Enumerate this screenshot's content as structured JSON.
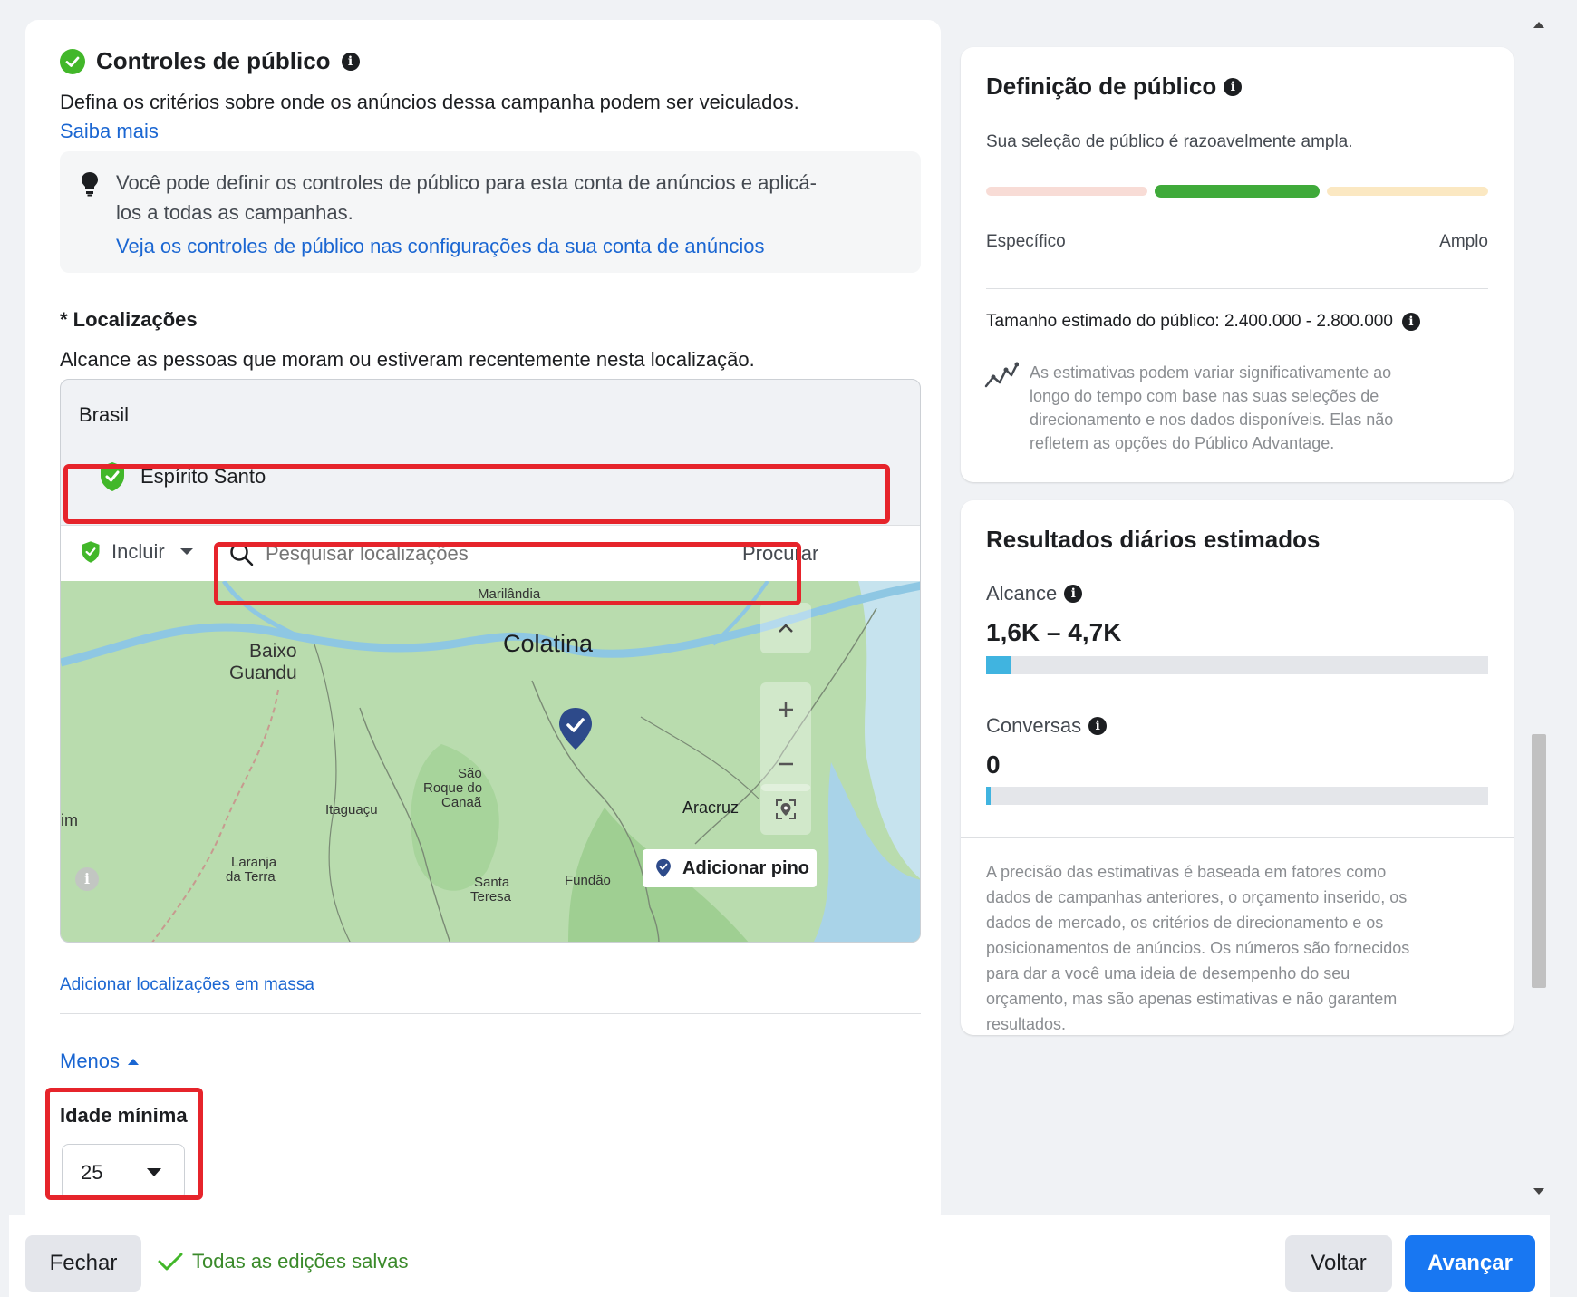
{
  "audience_controls": {
    "title": "Controles de público",
    "description": "Defina os critérios sobre onde os anúncios dessa campanha podem ser veiculados.",
    "learn_more": "Saiba mais",
    "tip_text_line1": "Você pode definir os controles de público para esta conta de anúncios e aplicá-",
    "tip_text_line2": "los a todas as campanhas.",
    "tip_link": "Veja os controles de público nas configurações da sua conta de anúncios"
  },
  "locations": {
    "label": "* Localizações",
    "description": "Alcance as pessoas que moram ou estiveram recentemente nesta localização.",
    "country": "Brasil",
    "selected_location": "Espírito Santo",
    "include_label": "Incluir",
    "search_placeholder": "Pesquisar localizações",
    "search_button": "Procurar",
    "bulk_add": "Adicionar localizações em massa",
    "add_pin": "Adicionar pino"
  },
  "map": {
    "labels": {
      "marilandia": "Marilândia",
      "colatina": "Colatina",
      "baixo": "Baixo",
      "guandu": "Guandu",
      "sao": "São",
      "roque": "Roque do",
      "canaa": "Canaã",
      "itaguacu": "Itaguaçu",
      "aracruz": "Aracruz",
      "im": "im",
      "laranja": "Laranja",
      "daterra": "da Terra",
      "santa": "Santa",
      "teresa": "Teresa",
      "fundao": "Fundão"
    }
  },
  "less_toggle": "Menos",
  "min_age": {
    "label": "Idade mínima",
    "value": "25"
  },
  "audience_definition": {
    "title": "Definição de público",
    "summary": "Sua seleção de público é razoavelmente ampla.",
    "specific_label": "Específico",
    "broad_label": "Amplo",
    "estimated_size": "Tamanho estimado do público: 2.400.000 - 2.800.000",
    "disclaimer_lines": [
      "As estimativas podem variar significativamente ao",
      "longo do tempo com base nas suas seleções de",
      "direcionamento e nos dados disponíveis. Elas não",
      "refletem as opções do Público Advantage."
    ]
  },
  "daily_results": {
    "title": "Resultados diários estimados",
    "reach_label": "Alcance",
    "reach_value": "1,6K – 4,7K",
    "conversations_label": "Conversas",
    "conversations_value": "0",
    "accuracy_lines": [
      "A precisão das estimativas é baseada em fatores como",
      "dados de campanhas anteriores, o orçamento inserido, os",
      "dados de mercado, os critérios de direcionamento e os",
      "posicionamentos de anúncios. Os números são fornecidos",
      "para dar a você uma ideia de desempenho do seu",
      "orçamento, mas são apenas estimativas e não garantem",
      "resultados."
    ]
  },
  "footer": {
    "close": "Fechar",
    "saved_status": "Todas as edições salvas",
    "back": "Voltar",
    "next": "Avançar"
  },
  "colors": {
    "accent": "#1877f2",
    "link": "#1a66d2",
    "green": "#42b72a",
    "highlight_red": "#e6242b"
  }
}
